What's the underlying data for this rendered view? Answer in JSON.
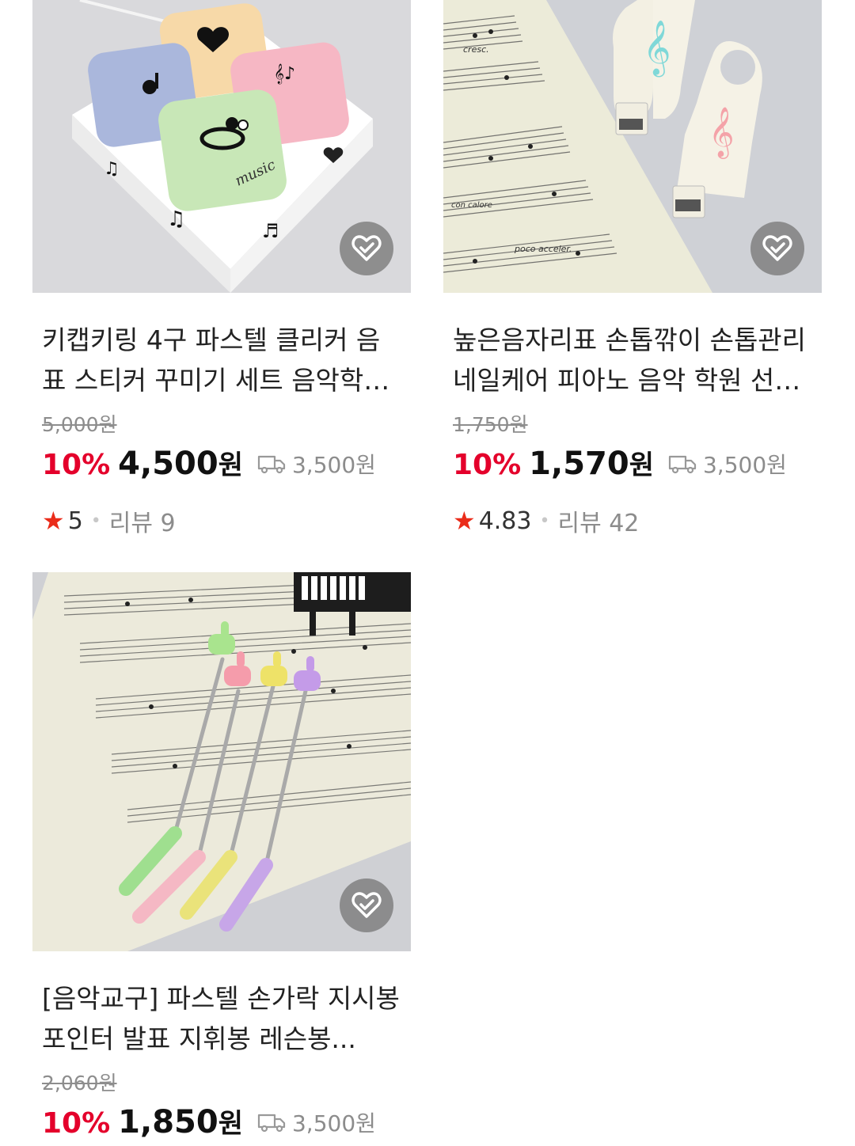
{
  "products": [
    {
      "title": "키캡키링 4구 파스텔 클리커 음표 스티커 꾸미기 세트 음악학원...",
      "original_price": "5,000원",
      "discount": "10%",
      "price": "4,500",
      "currency": "원",
      "shipping": "3,500원",
      "rating": "5",
      "reviews": "리뷰 9",
      "wish_icon": "heart-check-icon"
    },
    {
      "title": "높은음자리표 손톱깎이 손톱관리 네일케어 피아노 음악 학원 선물...",
      "original_price": "1,750원",
      "discount": "10%",
      "price": "1,570",
      "currency": "원",
      "shipping": "3,500원",
      "rating": "4.83",
      "reviews": "리뷰 42",
      "wish_icon": "heart-check-icon"
    },
    {
      "title": "[음악교구] 파스텔 손가락 지시봉 포인터 발표 지휘봉 레슨봉...",
      "original_price": "2,060원",
      "discount": "10%",
      "price": "1,850",
      "currency": "원",
      "shipping": "3,500원",
      "wish_icon": "heart-check-icon"
    }
  ],
  "colors": {
    "discount": "#e4002b",
    "star": "#ea2c1a",
    "muted": "#8c8c8c"
  }
}
